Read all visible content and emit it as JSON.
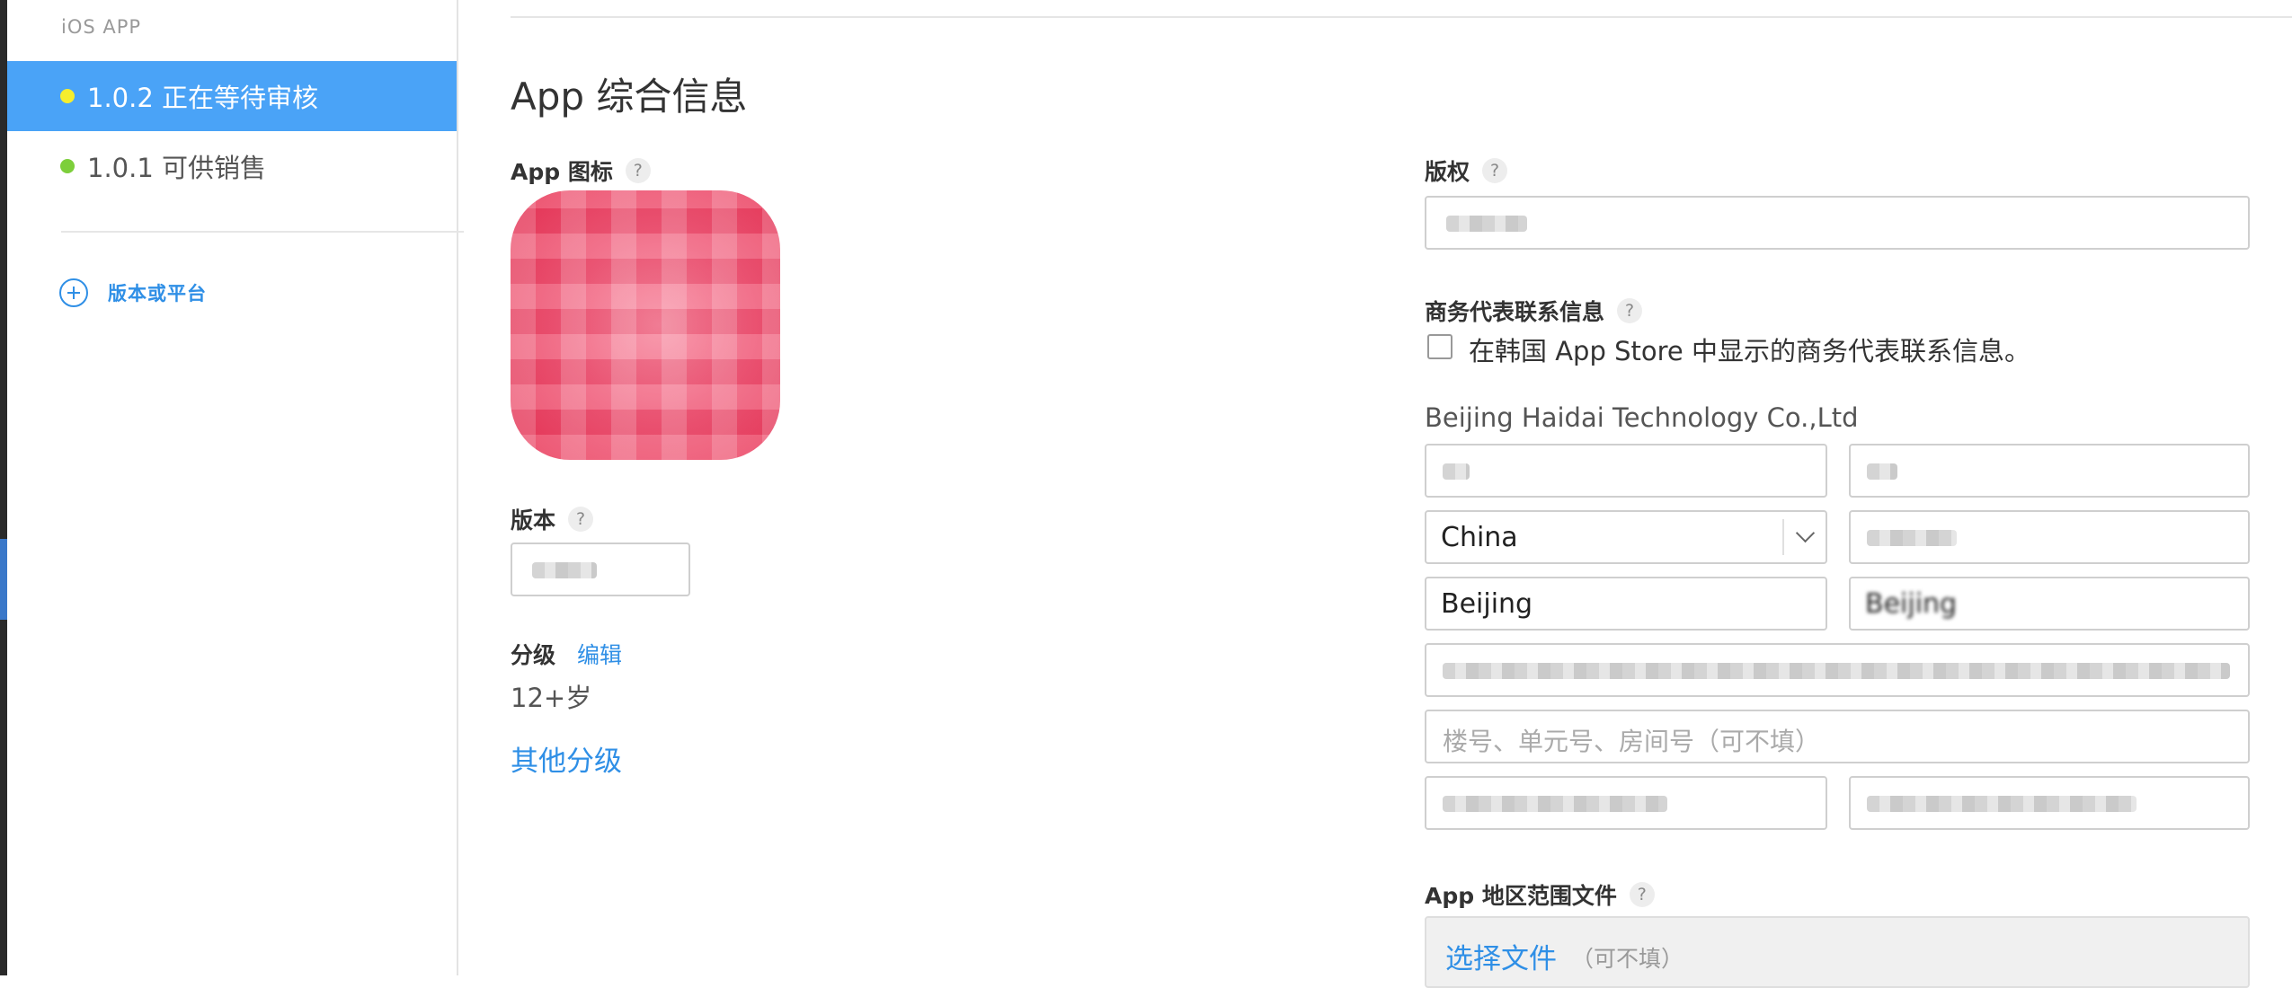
{
  "sidebar": {
    "title": "iOS APP",
    "versions": [
      {
        "label": "1.0.2 正在等待审核",
        "status_color": "#f5ee2e",
        "selected": true
      },
      {
        "label": "1.0.1 可供销售",
        "status_color": "#7dcf3b",
        "selected": false
      }
    ],
    "add_platform_label": "版本或平台"
  },
  "main": {
    "title": "App 综合信息",
    "icon_label": "App 图标",
    "version_label": "版本",
    "rating_label": "分级",
    "rating_edit": "编辑",
    "rating_value": "12+岁",
    "other_rating": "其他分级",
    "copyright_label": "版权",
    "business_label": "商务代表联系信息",
    "korea_checkbox_label": "在韩国 App Store 中显示的商务代表联系信息。",
    "company": "Beijing Haidai Technology Co.,Ltd",
    "country": "China",
    "city": "Beijing",
    "city2": "Beijing",
    "address2_placeholder": "楼号、单元号、房间号（可不填）",
    "region_file_label": "App 地区范围文件",
    "choose_file": "选择文件",
    "optional": "（可不填）",
    "help_glyph": "?"
  },
  "colors": {
    "accent": "#2f8fe6",
    "selected_bg": "#4aa3f7"
  }
}
